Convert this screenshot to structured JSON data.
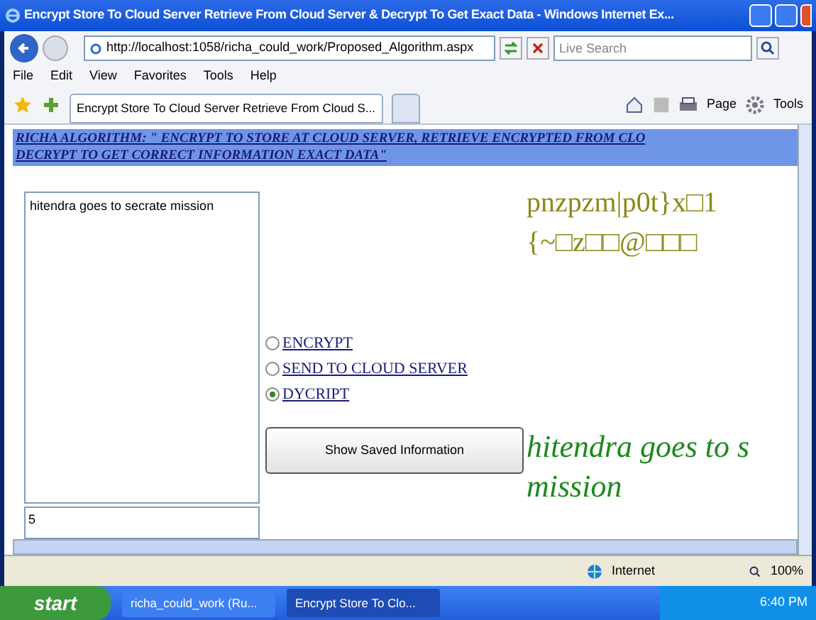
{
  "window": {
    "title": "Encrypt Store To Cloud Server Retrieve From Cloud Server & Decrypt To Get Exact Data - Windows Internet Ex..."
  },
  "address": {
    "url": "http://localhost:1058/richa_could_work/Proposed_Algorithm.aspx"
  },
  "search": {
    "placeholder": "Live Search"
  },
  "menu": [
    "File",
    "Edit",
    "View",
    "Favorites",
    "Tools",
    "Help"
  ],
  "tabs": [
    {
      "label": "Encrypt Store To Cloud Server Retrieve From Cloud S...",
      "selected": true
    },
    {
      "selected": false
    }
  ],
  "command_bar": {
    "page": "Page",
    "tools": "Tools"
  },
  "page": {
    "heading": [
      "RICHA ALGORITHM: \" ENCRYPT TO STORE AT CLOUD SERVER, RETRIEVE ENCRYPTED FROM CLO",
      "DECRYPT TO GET CORRECT INFORMATION EXACT DATA\""
    ],
    "input_text": "hitendra goes to secrate mission",
    "second_box": "5",
    "options": [
      {
        "label": "ENCRYPT",
        "selected": false
      },
      {
        "label": "SEND TO CLOUD SERVER",
        "selected": false
      },
      {
        "label": "DYCRIPT",
        "selected": true
      }
    ],
    "button": "Show Saved Information",
    "encrypted_lines": [
      "pnzpzm|p0t}x□1",
      "{~□z□□@□□□"
    ],
    "decrypted_lines": [
      "hitendra goes to s",
      "mission"
    ]
  },
  "status_bar": {
    "zone": "Internet",
    "zoom": "100%"
  },
  "taskbar": {
    "start": "start",
    "items": [
      {
        "label": "richa_could_work (Ru...",
        "selected": false
      },
      {
        "label": "Encrypt Store To Clo...",
        "selected": true
      }
    ],
    "clock": "6:40 PM"
  }
}
